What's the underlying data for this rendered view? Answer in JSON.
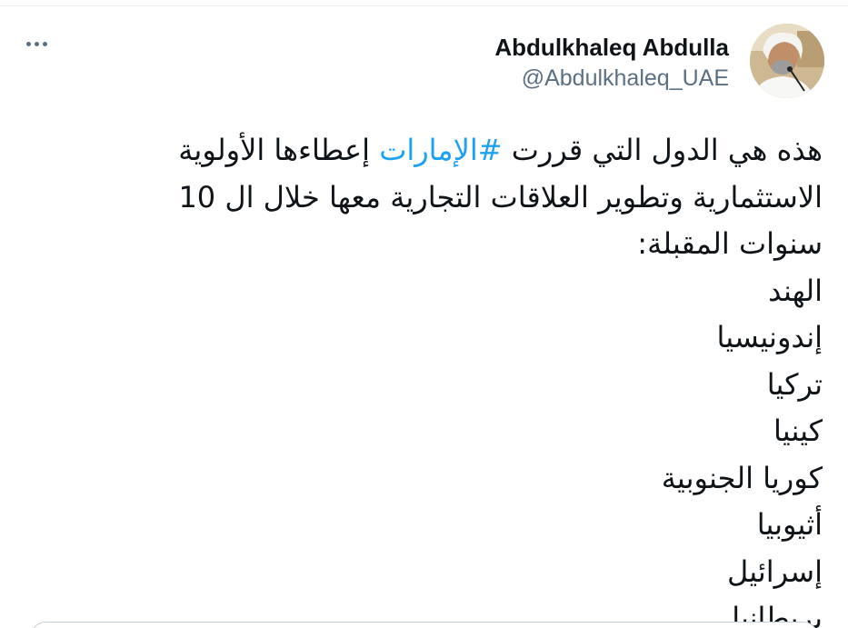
{
  "tweet": {
    "author": {
      "name": "Abdulkhaleq Abdulla",
      "handle": "@Abdulkhaleq_UAE"
    },
    "text": {
      "line1_before": "هذه هي الدول التي قررت ",
      "hashtag": "#الإمارات",
      "line1_after": " إعطاءها الأولوية",
      "line2": "الاستثمارية وتطوير العلاقات التجارية معها خلال ال 10",
      "line3": "سنوات المقبلة:",
      "countries": [
        "الهند",
        "إندونيسيا",
        "تركيا",
        "كينيا",
        "كوريا الجنوبية",
        "أثيوبيا",
        "إسرائيل",
        "بريطانيا"
      ]
    }
  },
  "icons": {
    "more": "more-horizontal-icon",
    "avatar": "profile-avatar"
  },
  "colors": {
    "hashtag": "#1da1f2",
    "text": "#0f1419",
    "secondary": "#5b7083"
  }
}
